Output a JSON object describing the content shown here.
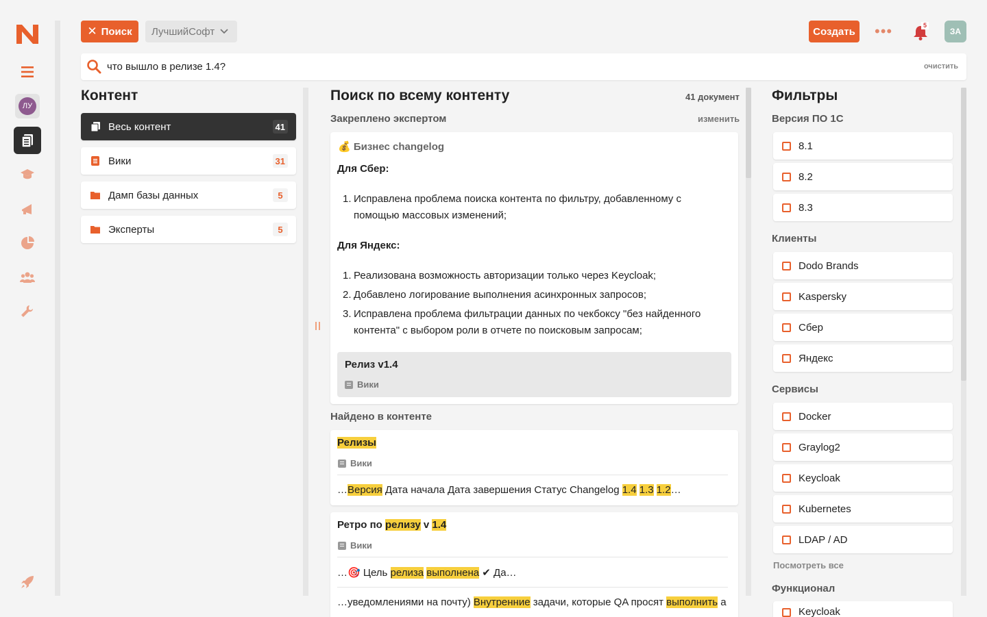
{
  "topbar": {
    "search_button": "Поиск",
    "company": "ЛучшийСофт",
    "create_button": "Создать",
    "more": "•••",
    "notifications_count": "5",
    "user_initials": "ЗА"
  },
  "nav": {
    "profile_initials": "ЛУ"
  },
  "search": {
    "query": "что вышло в релизе 1.4?",
    "clear_label": "очистить"
  },
  "content": {
    "title": "Контент",
    "categories": [
      {
        "label": "Весь контент",
        "count": "41"
      },
      {
        "label": "Вики",
        "count": "31"
      },
      {
        "label": "Дамп базы данных",
        "count": "5"
      },
      {
        "label": "Эксперты",
        "count": "5"
      }
    ]
  },
  "results": {
    "title": "Поиск по всему контенту",
    "count": "41 документ",
    "pinned_label": "Закреплено экспертом",
    "edit_label": "изменить",
    "pinned": {
      "header": "💰 Бизнес changelog",
      "sber_title": "Для Сбер:",
      "sber_items": [
        "Исправлена проблема поиска контента по фильтру, добавленному с помощью массовых изменений;"
      ],
      "yandex_title": "Для Яндекс:",
      "yandex_items": [
        "Реализована возможность авторизации только через Keycloak;",
        "Добавлено логирование выполнения асинхронных запросов;",
        "Исправлена проблема фильтрации данных по чекбоксу \"без найденного контента\" с выбором роли в отчете по поисковым запросам;"
      ],
      "release_title": "Релиз v1.4",
      "release_source": "Вики"
    },
    "found_label": "Найдено в контенте",
    "items": [
      {
        "title": "Релизы",
        "source": "Вики",
        "snippet": [
          "…",
          "Версия",
          " Дата начала Дата завершения Статус Changelog ",
          "1.4",
          " ",
          "1.3",
          " ",
          "1.2",
          "…"
        ]
      },
      {
        "title_parts": [
          "Ретро по ",
          "релизу",
          " v ",
          "1.4"
        ],
        "source": "Вики",
        "snippet1": [
          "…🎯 Цель ",
          "релиза",
          " ",
          "выполнена",
          " ✔ Да…"
        ],
        "snippet2": [
          "…уведомлениями на почту) ",
          "Внутренние",
          " задачи, которые QA просят ",
          "выполнить",
          " а"
        ]
      }
    ]
  },
  "filters": {
    "title": "Фильтры",
    "groups": [
      {
        "label": "Версия ПО 1С",
        "options": [
          "8.1",
          "8.2",
          "8.3"
        ]
      },
      {
        "label": "Клиенты",
        "options": [
          "Dodo Brands",
          "Kaspersky",
          "Сбер",
          "Яндекс"
        ]
      },
      {
        "label": "Сервисы",
        "options": [
          "Docker",
          "Graylog2",
          "Keycloak",
          "Kubernetes",
          "LDAP / AD"
        ]
      },
      {
        "label": "Функционал",
        "options": [
          "Keycloak"
        ]
      }
    ],
    "see_all": "Посмотреть все"
  },
  "colors": {
    "accent": "#e8602c",
    "highlight": "#f7cf3d",
    "dark": "#333333"
  }
}
